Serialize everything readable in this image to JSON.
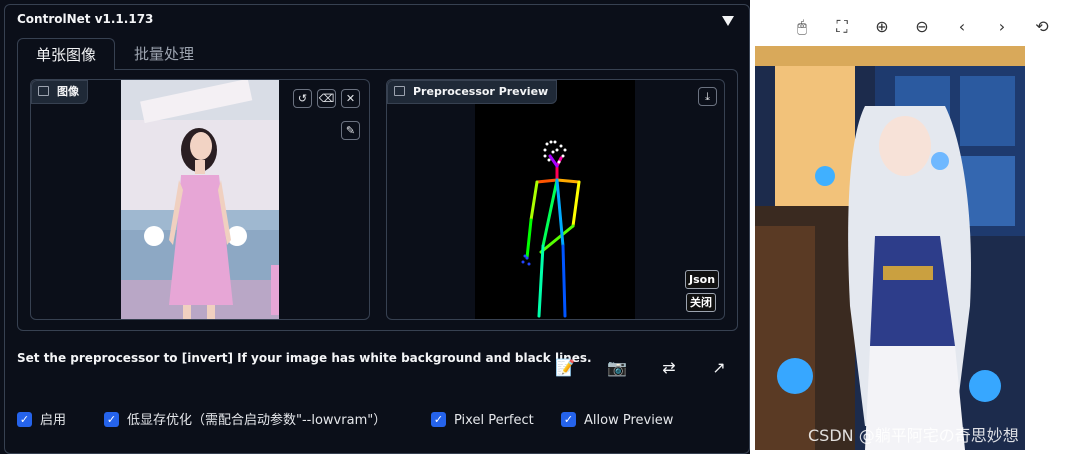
{
  "panel": {
    "title": "ControlNet v1.1.173",
    "tabs": [
      {
        "label": "单张图像"
      },
      {
        "label": "批量处理"
      }
    ]
  },
  "input_image": {
    "label": "图像"
  },
  "preview": {
    "label": "Preprocessor Preview",
    "json_button": "Json",
    "close_button": "关闭"
  },
  "hint_text": "Set the preprocessor to [invert] If your image has white background and black lines.",
  "options": [
    {
      "label": "启用",
      "checked": true
    },
    {
      "label": "低显存优化（需配合启动参数\"--lowvram\"）",
      "checked": true
    },
    {
      "label": "Pixel Perfect",
      "checked": true
    },
    {
      "label": "Allow Preview",
      "checked": true
    }
  ],
  "viewer": {
    "watermark": "CSDN @躺平阿宅の奇思妙想"
  }
}
